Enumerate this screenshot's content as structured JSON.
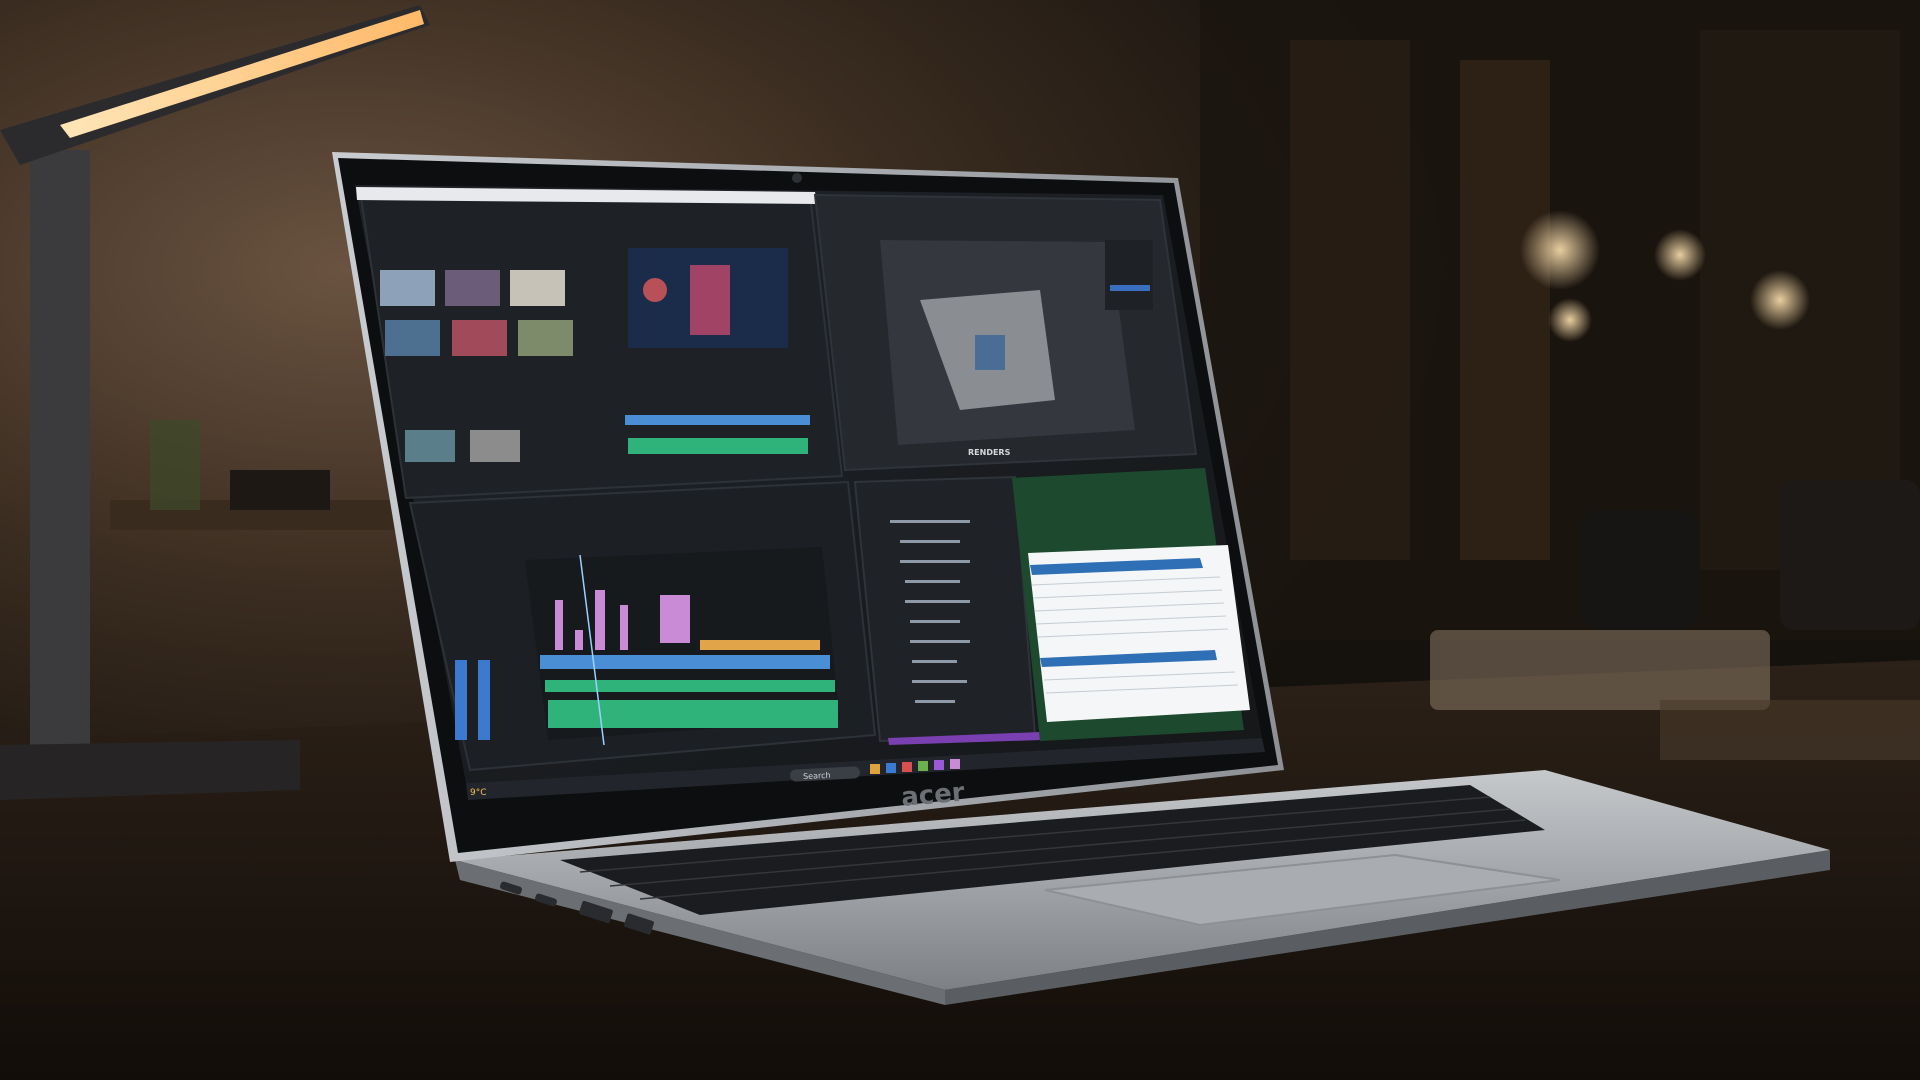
{
  "scene": {
    "subject": "laptop",
    "setting": "wooden desk in dim room with lamp",
    "colors": {
      "background_dark": "#14100c",
      "wall_warm": "#4a3a2c",
      "desk_wood": "#3a2a1e",
      "laptop_silver": "#b9bcbf",
      "laptop_bezel": "#0d0e10",
      "screen_dark": "#1c1f24",
      "timeline_green": "#2fb37a",
      "timeline_purple": "#c98ad6",
      "timeline_blue": "#4a8fd6",
      "lamp_glow": "#ffd9a0"
    }
  },
  "laptop": {
    "brand_logo": "acer",
    "screen_apps": [
      "video-editor",
      "3d-modeling-app",
      "spreadsheet-app"
    ],
    "screen_label_3d": "RENDERS"
  },
  "taskbar": {
    "search_label": "Search",
    "weather": "9°C"
  }
}
